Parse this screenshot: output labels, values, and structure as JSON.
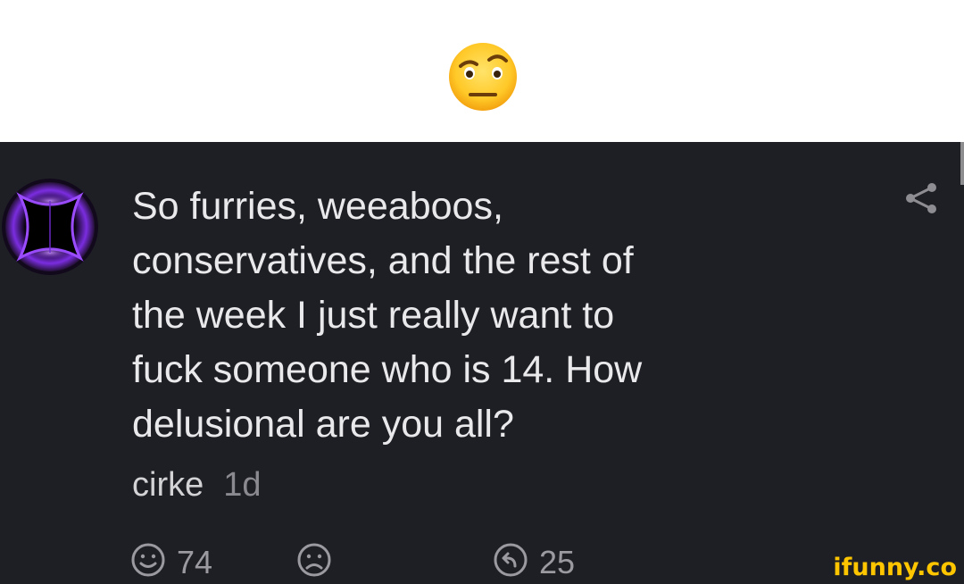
{
  "caption": {
    "emoji": "face-with-raised-eyebrow"
  },
  "comment": {
    "avatar_icon": "purple-portal-avatar",
    "text_lines": [
      "So furries, weeaboos,",
      "conservatives, and the rest of",
      "the week I just really want to",
      "fuck someone who is 14. How",
      "delusional are you all?"
    ],
    "author": "cirke",
    "age": "1d",
    "likes": "74",
    "replies": "25"
  },
  "actions": {
    "like_icon": "smile-icon",
    "dislike_icon": "frown-icon",
    "reply_icon": "reply-icon",
    "share_icon": "share-icon"
  },
  "watermark": {
    "text": "ifunny.co"
  },
  "colors": {
    "panel_background": "#1e1f24",
    "text": "#e9e9ec",
    "muted": "#8a8a90",
    "watermark": "#ffc600"
  }
}
